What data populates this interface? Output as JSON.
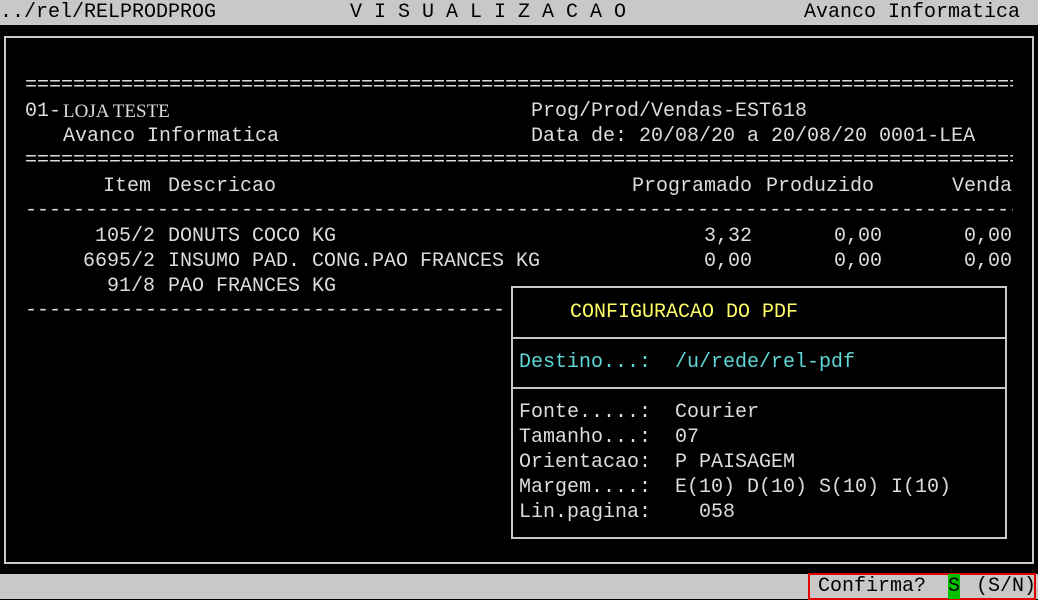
{
  "header": {
    "path": "../rel/RELPRODPROG",
    "mode": "V I S U A L I Z A C A O",
    "company": "Avanco Informatica"
  },
  "report": {
    "double_rule": "=======================================================================================================================",
    "single_rule": "-------------------------------------------------------------------------------------------------------------------------",
    "store_code": "01-",
    "store_name": "LOJA TESTE",
    "company_name": "Avanco Informatica",
    "program": "Prog/Prod/Vendas-EST618",
    "date_line": "Data de: 20/08/20 a 20/08/20 0001-LEA",
    "columns": {
      "item": "Item",
      "description": "Descricao",
      "programmed": "Programado",
      "produced": "Produzido",
      "sales": "Venda"
    },
    "rows": [
      {
        "item": "105/2",
        "description": "DONUTS COCO KG",
        "programmed": "3,32",
        "produced": "0,00",
        "sales": "0,00"
      },
      {
        "item": "6695/2",
        "description": "INSUMO PAD. CONG.PAO FRANCES KG",
        "programmed": "0,00",
        "produced": "0,00",
        "sales": "0,00"
      },
      {
        "item": "91/8",
        "description": "PAO FRANCES KG",
        "programmed": "",
        "produced": "",
        "sales": ""
      }
    ]
  },
  "pdf_dialog": {
    "title": "CONFIGURACAO DO PDF",
    "destination_label": "Destino...:",
    "destination_value": "/u/rede/rel-pdf",
    "font_label": "Fonte.....:",
    "font_value": "Courier",
    "size_label": "Tamanho...:",
    "size_value": "07",
    "orientation_label": "Orientacao:",
    "orientation_value": "P PAISAGEM",
    "margin_label": "Margem....:",
    "margin_value": "E(10) D(10) S(10) I(10)",
    "lines_label": "Lin.pagina:",
    "lines_value": "058"
  },
  "footer": {
    "prompt": "Confirma?",
    "answer": "S",
    "options": "(S/N)"
  },
  "colors": {
    "title": "#ffff66",
    "destination": "#5fd7d7",
    "answer_highlight": "#00c000",
    "confirm_border": "#e00000"
  }
}
